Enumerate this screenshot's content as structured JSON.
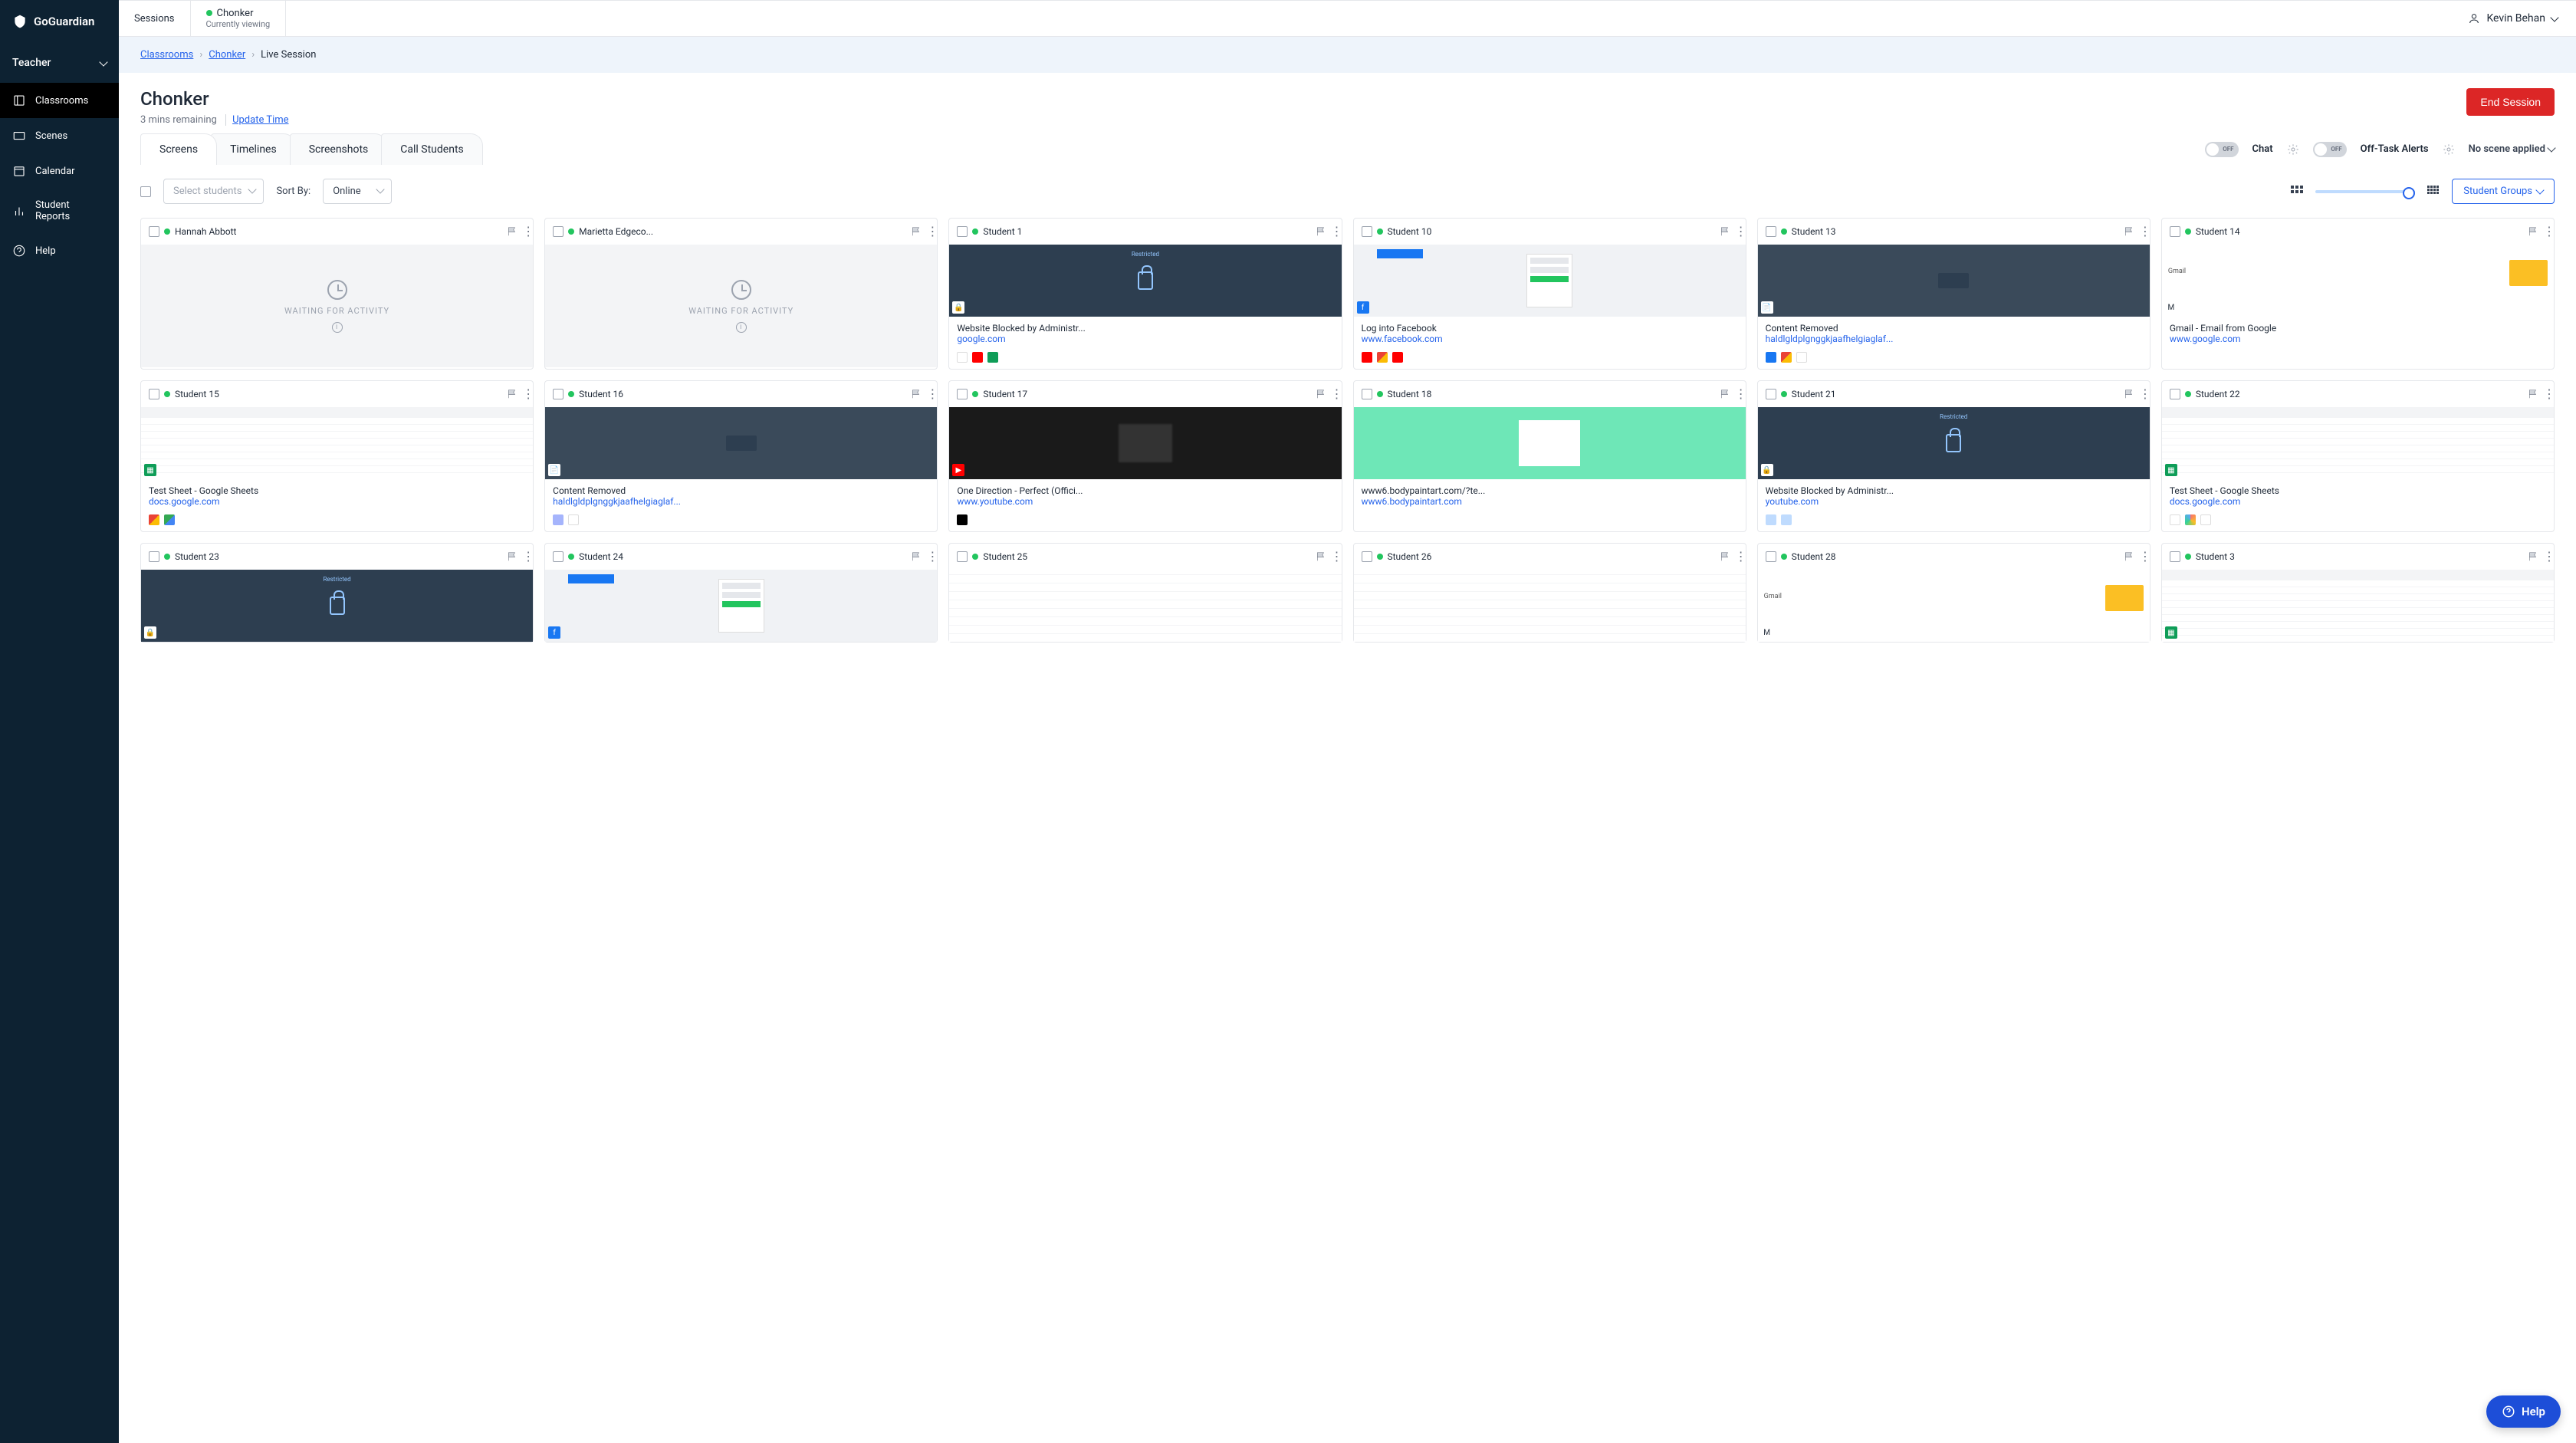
{
  "brand": "GoGuardian",
  "role": "Teacher",
  "nav": {
    "classrooms": "Classrooms",
    "scenes": "Scenes",
    "calendar": "Calendar",
    "reports": "Student Reports",
    "help": "Help"
  },
  "tabs": {
    "sessions": "Sessions",
    "current_name": "Chonker",
    "current_status": "Currently viewing"
  },
  "user": "Kevin Behan",
  "breadcrumb": {
    "a": "Classrooms",
    "b": "Chonker",
    "c": "Live Session"
  },
  "header": {
    "title": "Chonker",
    "remaining": "3 mins remaining",
    "update": "Update Time",
    "end": "End Session"
  },
  "viewtabs": {
    "screens": "Screens",
    "timelines": "Timelines",
    "screenshots": "Screenshots",
    "call": "Call Students"
  },
  "toggles": {
    "off": "OFF",
    "chat": "Chat",
    "offtask": "Off-Task Alerts",
    "scene": "No scene applied"
  },
  "controls": {
    "select_placeholder": "Select students",
    "sort_label": "Sort By:",
    "sort_value": "Online",
    "groups": "Student Groups"
  },
  "waiting": "WAITING FOR ACTIVITY",
  "cards": [
    {
      "name": "Hannah Abbott",
      "waiting": true
    },
    {
      "name": "Marietta Edgeco...",
      "waiting": true
    },
    {
      "name": "Student 1",
      "title": "Website Blocked by Administr...",
      "url": "google.com",
      "shot": "blocked",
      "favs": [
        "doc",
        "youtube",
        "sheets"
      ]
    },
    {
      "name": "Student 10",
      "title": "Log into Facebook",
      "url": "www.facebook.com",
      "shot": "fb",
      "favs": [
        "youtube",
        "gmail",
        "youtube"
      ]
    },
    {
      "name": "Student 13",
      "title": "Content Removed",
      "url": "haldlgldplgnggkjaafhelgiaglaf...",
      "shot": "removed",
      "favs": [
        "fbblue",
        "gmail",
        "doc"
      ]
    },
    {
      "name": "Student 14",
      "title": "Gmail - Email from Google",
      "url": "www.google.com",
      "shot": "gmail",
      "favs": []
    },
    {
      "name": "Student 15",
      "title": "Test Sheet - Google Sheets",
      "url": "docs.google.com",
      "shot": "sheets",
      "favs": [
        "gmail",
        "gmail2"
      ]
    },
    {
      "name": "Student 16",
      "title": "Content Removed",
      "url": "haldlgldplgnggkjaafhelgiaglaf...",
      "shot": "removed",
      "favs": [
        "ext",
        "doc"
      ]
    },
    {
      "name": "Student 17",
      "title": "One Direction - Perfect (Offici...",
      "url": "www.youtube.com",
      "shot": "yt",
      "favs": [
        "mono"
      ]
    },
    {
      "name": "Student 18",
      "title": "www6.bodypaintart.com/?te...",
      "url": "www6.bodypaintart.com",
      "shot": "green",
      "favs": []
    },
    {
      "name": "Student 21",
      "title": "Website Blocked by Administr...",
      "url": "youtube.com",
      "shot": "blocked",
      "favs": [
        "lock",
        "lock"
      ]
    },
    {
      "name": "Student 22",
      "title": "Test Sheet - Google Sheets",
      "url": "docs.google.com",
      "shot": "sheets",
      "favs": [
        "doc",
        "palette",
        "doc"
      ]
    },
    {
      "name": "Student 23",
      "shot": "blocked"
    },
    {
      "name": "Student 24",
      "shot": "fb"
    },
    {
      "name": "Student 25",
      "shot": "light"
    },
    {
      "name": "Student 26",
      "shot": "light"
    },
    {
      "name": "Student 28",
      "shot": "gmail"
    },
    {
      "name": "Student 3",
      "shot": "sheets"
    }
  ],
  "help_btn": "Help"
}
